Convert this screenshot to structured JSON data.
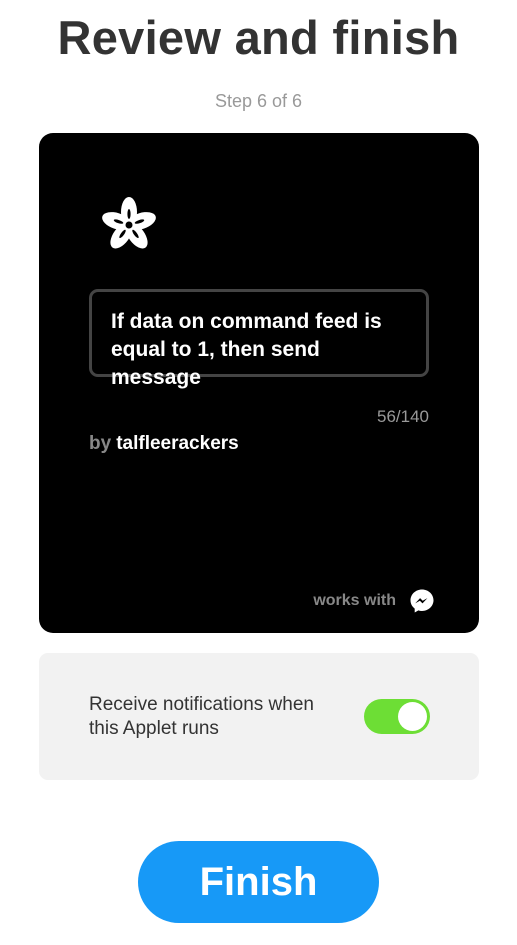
{
  "header": {
    "title": "Review and finish",
    "step": "Step 6 of 6"
  },
  "applet": {
    "service_logo_icon": "adafruit-flower-icon",
    "title": "If data on command feed is equal to 1, then send message",
    "char_count": "56/140",
    "byline_prefix": "by",
    "author": "talfleerackers",
    "works_with_label": "works with",
    "works_with_icon": "messenger-icon",
    "card_color": "#000000"
  },
  "notifications": {
    "label": "Receive notifications when this Applet runs",
    "enabled": true,
    "toggle_color": "#6dde35"
  },
  "footer": {
    "finish_label": "Finish",
    "finish_color": "#1799f7"
  }
}
